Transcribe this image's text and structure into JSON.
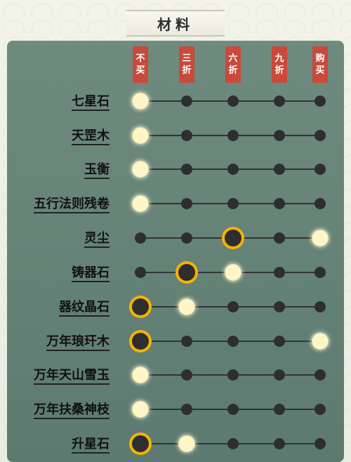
{
  "title": "材料",
  "headers": [
    {
      "top": "不",
      "bottom": "买"
    },
    {
      "top": "三",
      "bottom": "折"
    },
    {
      "top": "六",
      "bottom": "折"
    },
    {
      "top": "九",
      "bottom": "折"
    },
    {
      "top": "购",
      "bottom": "买"
    }
  ],
  "rows": [
    {
      "label": "七星石",
      "states": [
        "selected",
        "off",
        "off",
        "off",
        "off"
      ]
    },
    {
      "label": "天罡木",
      "states": [
        "selected",
        "off",
        "off",
        "off",
        "off"
      ]
    },
    {
      "label": "玉衡",
      "states": [
        "selected",
        "off",
        "off",
        "off",
        "off"
      ]
    },
    {
      "label": "五行法则残卷",
      "states": [
        "selected",
        "off",
        "off",
        "off",
        "off"
      ]
    },
    {
      "label": "灵尘",
      "states": [
        "off",
        "off",
        "current",
        "off",
        "selected"
      ]
    },
    {
      "label": "铸器石",
      "states": [
        "off",
        "current",
        "selected",
        "off",
        "off"
      ]
    },
    {
      "label": "器纹晶石",
      "states": [
        "current",
        "selected",
        "off",
        "off",
        "off"
      ]
    },
    {
      "label": "万年琅玕木",
      "states": [
        "current",
        "off",
        "off",
        "off",
        "selected"
      ]
    },
    {
      "label": "万年天山雪玉",
      "states": [
        "selected",
        "off",
        "off",
        "off",
        "off"
      ]
    },
    {
      "label": "万年扶桑神枝",
      "states": [
        "selected",
        "off",
        "off",
        "off",
        "off"
      ]
    },
    {
      "label": "升星石",
      "states": [
        "current",
        "selected",
        "off",
        "off",
        "off"
      ]
    }
  ],
  "colors": {
    "header_bg": "#c94a3a",
    "accent_ring": "#f5b300",
    "selected_glow": "#fff6c8",
    "panel_bg": "#6f8b7f"
  }
}
